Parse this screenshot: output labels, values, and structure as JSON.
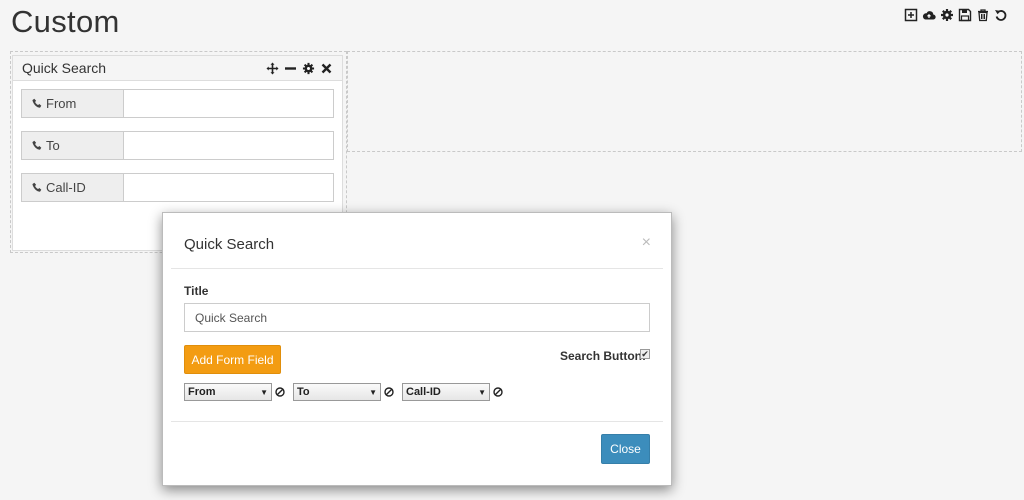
{
  "page": {
    "title": "Custom"
  },
  "toolbar": {
    "icons": [
      "plus-square-icon",
      "cloud-upload-icon",
      "gear-icon",
      "save-icon",
      "trash-icon",
      "undo-icon"
    ]
  },
  "widget": {
    "title": "Quick Search",
    "tools": [
      "move-icon",
      "minimize-icon",
      "gear-icon",
      "close-icon"
    ],
    "fields": [
      {
        "label": "From",
        "value": ""
      },
      {
        "label": "To",
        "value": ""
      },
      {
        "label": "Call-ID",
        "value": ""
      }
    ]
  },
  "modal": {
    "title": "Quick Search",
    "close_glyph": "×",
    "title_label": "Title",
    "title_value": "Quick Search",
    "add_field_label": "Add Form Field",
    "search_button_label": "Search Button:",
    "search_button_checked": true,
    "selects": [
      {
        "value": "From"
      },
      {
        "value": "To"
      },
      {
        "value": "Call-ID"
      }
    ],
    "close_button_label": "Close"
  },
  "colors": {
    "accent_orange": "#f39c12",
    "accent_blue": "#3c8dbc",
    "background": "#f5f5f5"
  }
}
